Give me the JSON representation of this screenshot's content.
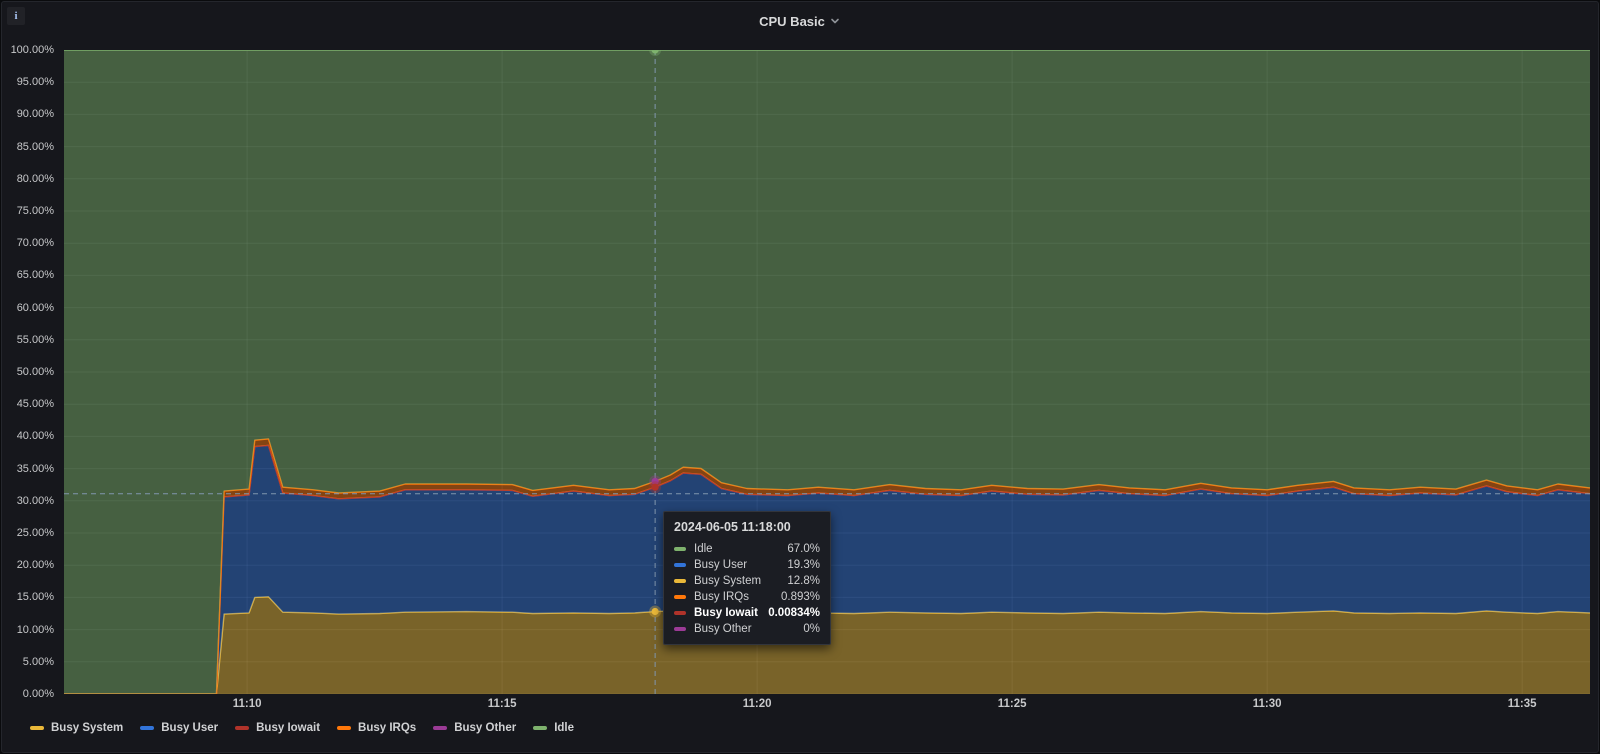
{
  "panel": {
    "title": "CPU Basic",
    "info_icon": "i",
    "chevron_icon": "chevron-down"
  },
  "colors": {
    "panel_bg": "#16171c",
    "grid": "rgba(204,212,224,0.10)",
    "crosshair": "#8096ad",
    "axis_text": "#c7c8ca"
  },
  "chart_data": {
    "type": "area",
    "stacked": true,
    "unit": "percent",
    "ylim": [
      0,
      100
    ],
    "grid": true,
    "legend_position": "bottom-left",
    "y_ticks": [
      "0.00%",
      "5.00%",
      "10.00%",
      "15.00%",
      "20.00%",
      "25.00%",
      "30.00%",
      "35.00%",
      "40.00%",
      "45.00%",
      "50.00%",
      "55.00%",
      "60.00%",
      "65.00%",
      "70.00%",
      "75.00%",
      "80.00%",
      "85.00%",
      "90.00%",
      "95.00%",
      "100.00%"
    ],
    "x_ticks": [
      {
        "label": "11:10",
        "t": 10
      },
      {
        "label": "11:15",
        "t": 15
      },
      {
        "label": "11:20",
        "t": 20
      },
      {
        "label": "11:25",
        "t": 25
      },
      {
        "label": "11:30",
        "t": 30
      },
      {
        "label": "11:35",
        "t": 35
      }
    ],
    "time_axis": {
      "start_min": 6.41,
      "end_min": 36.33,
      "reference": "minutes after 11:00"
    },
    "t_minutes": [
      6.41,
      9.4,
      9.55,
      10.04,
      10.15,
      10.42,
      10.7,
      11.3,
      11.8,
      12.6,
      13.1,
      14.3,
      15.2,
      15.6,
      16.4,
      17.1,
      17.6,
      18.0,
      18.3,
      18.55,
      18.9,
      19.3,
      19.8,
      20.6,
      21.2,
      21.9,
      22.6,
      23.3,
      24.0,
      24.6,
      25.3,
      26.0,
      26.7,
      27.3,
      28.0,
      28.7,
      29.3,
      30.0,
      30.6,
      31.3,
      31.7,
      32.4,
      33.0,
      33.7,
      34.3,
      34.7,
      35.3,
      35.7,
      36.33
    ],
    "series": [
      {
        "name": "Busy System",
        "color": "#EAB839",
        "values": [
          0,
          0,
          12.4,
          12.6,
          15.0,
          15.1,
          12.7,
          12.6,
          12.4,
          12.5,
          12.7,
          12.8,
          12.7,
          12.5,
          12.6,
          12.5,
          12.6,
          12.8,
          12.9,
          13.0,
          12.9,
          12.7,
          12.6,
          12.5,
          12.6,
          12.5,
          12.7,
          12.6,
          12.5,
          12.7,
          12.6,
          12.5,
          12.7,
          12.6,
          12.5,
          12.8,
          12.6,
          12.5,
          12.7,
          12.9,
          12.6,
          12.5,
          12.6,
          12.5,
          12.9,
          12.7,
          12.5,
          12.8,
          12.6
        ]
      },
      {
        "name": "Busy User",
        "color": "#3274D9",
        "values": [
          0,
          0,
          18.2,
          18.3,
          23.4,
          23.5,
          18.5,
          18.2,
          17.9,
          18.1,
          19.0,
          18.9,
          18.9,
          18.2,
          18.9,
          18.3,
          18.4,
          19.3,
          20.2,
          21.3,
          21.2,
          19.2,
          18.4,
          18.3,
          18.6,
          18.3,
          18.9,
          18.4,
          18.3,
          18.8,
          18.4,
          18.4,
          18.9,
          18.5,
          18.3,
          19.0,
          18.5,
          18.3,
          18.8,
          19.2,
          18.5,
          18.3,
          18.6,
          18.4,
          19.4,
          18.7,
          18.3,
          18.9,
          18.5
        ]
      },
      {
        "name": "Busy Iowait",
        "color": "#B0332A",
        "values": [
          0,
          0,
          0.01,
          0.01,
          0.01,
          0.01,
          0.01,
          0.01,
          0.01,
          0.01,
          0.01,
          0.01,
          0.01,
          0.01,
          0.01,
          0.01,
          0.01,
          0.01,
          0.01,
          0.01,
          0.01,
          0.01,
          0.01,
          0.01,
          0.01,
          0.01,
          0.01,
          0.01,
          0.01,
          0.01,
          0.01,
          0.01,
          0.01,
          0.01,
          0.01,
          0.01,
          0.01,
          0.01,
          0.01,
          0.01,
          0.01,
          0.01,
          0.01,
          0.01,
          0.01,
          0.01,
          0.01,
          0.01,
          0.01
        ]
      },
      {
        "name": "Busy IRQs",
        "color": "#FF780A",
        "values": [
          0,
          0,
          0.9,
          0.9,
          1.0,
          1.0,
          0.9,
          0.9,
          0.9,
          0.9,
          0.9,
          0.9,
          0.9,
          0.9,
          0.9,
          0.9,
          0.9,
          0.9,
          0.9,
          0.9,
          0.9,
          0.9,
          0.9,
          0.9,
          0.9,
          0.9,
          0.9,
          0.9,
          0.9,
          0.9,
          0.9,
          0.9,
          0.9,
          0.9,
          0.9,
          0.9,
          0.9,
          0.9,
          0.9,
          0.9,
          0.9,
          0.9,
          0.9,
          0.9,
          0.9,
          0.9,
          0.9,
          0.9,
          0.9
        ]
      },
      {
        "name": "Busy Other",
        "color": "#9B3B96",
        "values": [
          0,
          0,
          0,
          0,
          0,
          0,
          0,
          0,
          0,
          0,
          0,
          0,
          0,
          0,
          0,
          0,
          0,
          0,
          0,
          0,
          0,
          0,
          0,
          0,
          0,
          0,
          0,
          0,
          0,
          0,
          0,
          0,
          0,
          0,
          0,
          0,
          0,
          0,
          0,
          0,
          0,
          0,
          0,
          0,
          0,
          0,
          0,
          0,
          0
        ]
      },
      {
        "name": "Idle",
        "color": "#7EB26D",
        "values": [
          100,
          100,
          68.49,
          68.19,
          60.59,
          60.39,
          67.89,
          68.29,
          68.79,
          68.49,
          67.39,
          67.39,
          67.49,
          68.39,
          67.59,
          68.29,
          68.09,
          66.99,
          65.99,
          64.79,
          64.99,
          67.19,
          68.09,
          68.29,
          67.89,
          68.29,
          67.49,
          68.09,
          68.29,
          67.59,
          68.09,
          68.19,
          67.49,
          67.99,
          68.29,
          67.29,
          67.99,
          68.29,
          67.59,
          66.99,
          67.99,
          68.29,
          67.89,
          68.19,
          66.79,
          67.69,
          68.29,
          67.39,
          67.99
        ]
      }
    ],
    "fill_opacity": 0.47
  },
  "hover": {
    "time_label": "2024-06-05 11:18:00",
    "t": 18,
    "crosshair_y_pct": 31.1,
    "rows": [
      {
        "name": "Idle",
        "value": "67.0%",
        "color": "#7EB26D",
        "bold": false
      },
      {
        "name": "Busy User",
        "value": "19.3%",
        "color": "#3274D9",
        "bold": false
      },
      {
        "name": "Busy System",
        "value": "12.8%",
        "color": "#EAB839",
        "bold": false
      },
      {
        "name": "Busy IRQs",
        "value": "0.893%",
        "color": "#FF780A",
        "bold": false
      },
      {
        "name": "Busy Iowait",
        "value": "0.00834%",
        "color": "#B0332A",
        "bold": true
      },
      {
        "name": "Busy Other",
        "value": "0%",
        "color": "#9B3B96",
        "bold": false
      }
    ],
    "markers": [
      {
        "pct": 100,
        "color": "#7EB26D"
      },
      {
        "pct": 33.01,
        "color": "#9B3B96"
      },
      {
        "pct": 32.11,
        "color": "#B0332A"
      },
      {
        "pct": 12.81,
        "color": "#EAB839"
      }
    ]
  }
}
